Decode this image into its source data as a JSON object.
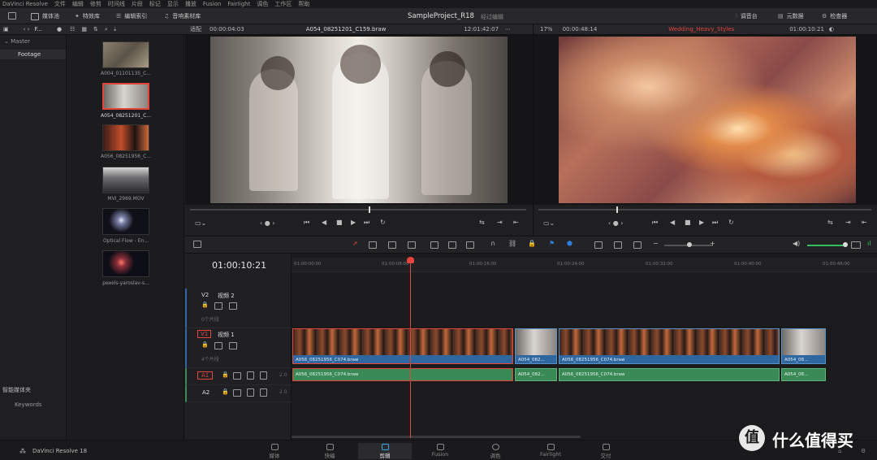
{
  "menubar": {
    "items": [
      "DaVinci Resolve",
      "文件",
      "编辑",
      "修剪",
      "时间线",
      "片段",
      "标记",
      "显示",
      "播放",
      "Fusion",
      "Fairlight",
      "调色",
      "工作区",
      "帮助"
    ]
  },
  "toolbar": {
    "media_pool": "媒体池",
    "effects": "特效库",
    "edit_index": "编辑索引",
    "sound_library": "音响素材库",
    "project_title": "SampleProject_R18",
    "project_status": "经过编辑",
    "mixer": "调音台",
    "metadata": "元数据",
    "inspector": "检查器"
  },
  "bins_panel": {
    "master": "Master",
    "footage": "Footage",
    "smart_bins": "智能媒体夹",
    "keywords": "Keywords",
    "f_label": "F..."
  },
  "clips": [
    {
      "name": "A004_01101135_C..."
    },
    {
      "name": "A054_08251201_C..."
    },
    {
      "name": "A056_08251956_C..."
    },
    {
      "name": "MVI_2969.MOV"
    },
    {
      "name": "Optical Flow - En..."
    },
    {
      "name": "pexels-yaroslav-s..."
    }
  ],
  "source_viewer": {
    "fit": "适配",
    "timecode_left": "00:00:04:03",
    "clip_name": "A054_08251201_C159.braw",
    "timecode_right": "12:01:42:07"
  },
  "timeline_viewer": {
    "zoom": "17%",
    "timecode_left": "00:00:48:14",
    "timeline_name": "Wedding_Heavy_Styles",
    "timecode_right": "01:00:10:21"
  },
  "timeline": {
    "current_tc": "01:00:10:21",
    "ruler": [
      "01:00:00:00",
      "01:00:08:00",
      "01:00:16:00",
      "01:00:24:00",
      "01:00:32:00",
      "01:00:40:00",
      "01:00:48:00"
    ],
    "tracks": {
      "v2": {
        "id": "V2",
        "name": "视频 2",
        "count": "0个片段"
      },
      "v1": {
        "id": "V1",
        "name": "视频 1",
        "count": "4个片段"
      },
      "a1": {
        "id": "A1",
        "ch": "2.0"
      },
      "a2": {
        "id": "A2",
        "ch": "2.0"
      }
    },
    "video_clips": [
      "A056_08251956_C074.braw",
      "A054_082...",
      "A056_08251956_C074.braw",
      "A054_08..."
    ],
    "audio_clips": [
      "A056_08251956_C074.braw",
      "A054_082...",
      "A056_08251956_C074.braw",
      "A054_08..."
    ]
  },
  "bottom": {
    "app_name": "DaVinci Resolve 18",
    "pages": [
      "媒体",
      "快编",
      "剪辑",
      "Fusion",
      "调色",
      "Fairlight",
      "交付"
    ],
    "watermark": "什么值得买"
  },
  "colors": {
    "accent_red": "#e5453b",
    "video_clip": "#2f67a0",
    "audio_clip": "#3a8a58",
    "timeline_name": "#e5453b"
  }
}
